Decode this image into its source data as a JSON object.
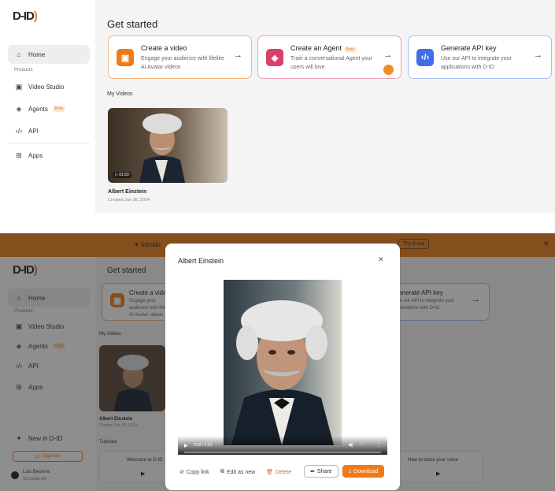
{
  "brand": {
    "logo_text": "D-ID",
    "bracket": ")"
  },
  "sidebar": {
    "home": "Home",
    "products_label": "Products",
    "video_studio": "Video Studio",
    "agents": "Agents",
    "agents_badge": "Beta",
    "api": "API",
    "apps": "Apps",
    "new_in": "New in D-ID",
    "upgrade": "Upgrade",
    "user_name": "Luis Becerra",
    "credits": "12 credits left"
  },
  "main": {
    "title": "Get started",
    "cards": [
      {
        "title": "Create a video",
        "desc": "Engage your audience with lifelike AI Avatar videos",
        "icon": "video-icon"
      },
      {
        "title": "Create an Agent",
        "badge": "Beta",
        "desc": "Train a conversational Agent your users will love",
        "icon": "agent-icon"
      },
      {
        "title": "Generate API key",
        "desc": "Use our API to integrate your applications with D-ID",
        "icon": "code-icon"
      }
    ],
    "my_videos_label": "My Videos",
    "video": {
      "title": "Albert Einstein",
      "created": "Created Jun 30, 2024",
      "duration": "01:50"
    },
    "tutorials_label": "Tutorials",
    "tutorial_1": "Welcome to D-ID",
    "tutorial_3": "How to clone your voice"
  },
  "banner": {
    "text": "Introdu",
    "cta": "Try it out"
  },
  "modal": {
    "title": "Albert Einstein",
    "time": "0:02 / 1:51",
    "copy_link": "Copy link",
    "edit_as_new": "Edit as new",
    "delete": "Delete",
    "share": "Share",
    "download": "Download"
  },
  "colors": {
    "accent": "#f07a1a",
    "banner": "#e8801c",
    "blue": "#3f6fe6",
    "pink": "#d93f6a"
  }
}
